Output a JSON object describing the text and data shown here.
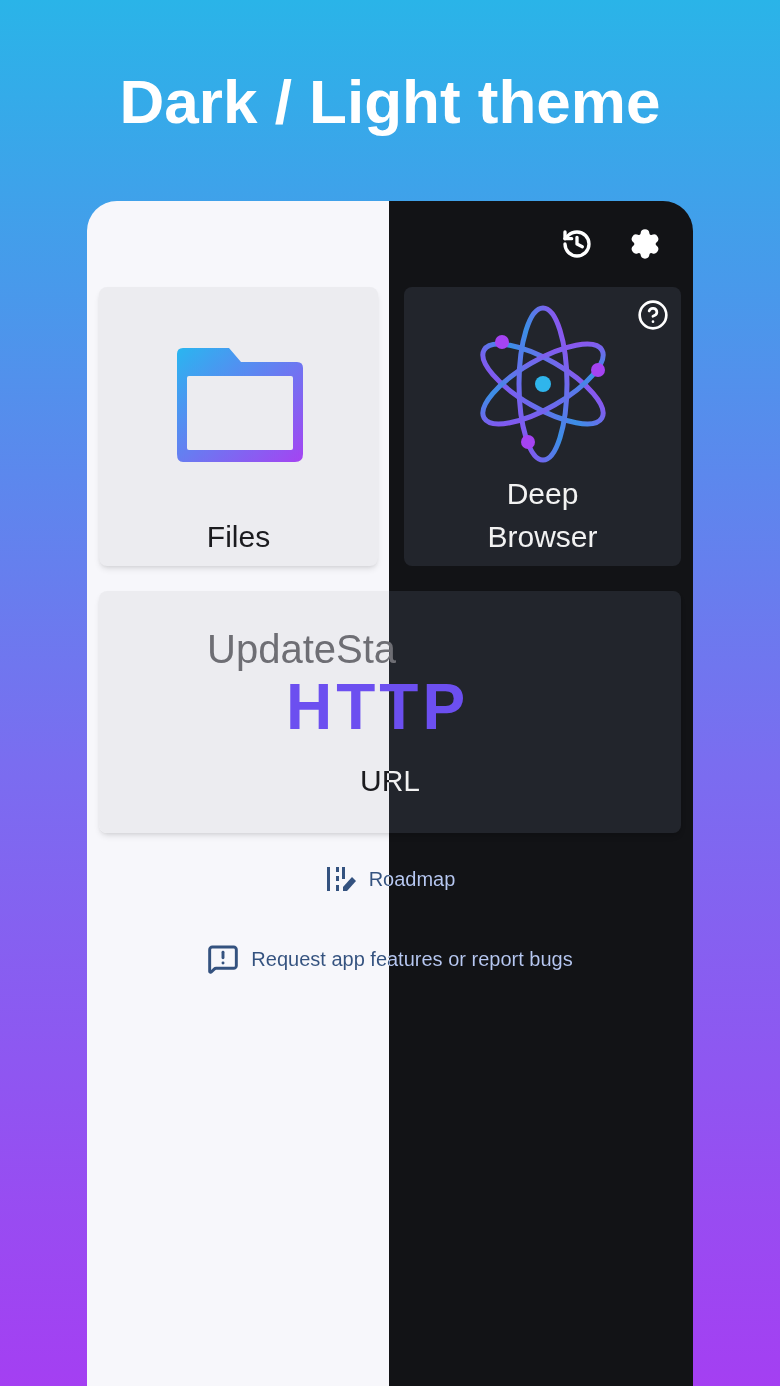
{
  "headline": "Dark / Light theme",
  "tiles": [
    {
      "kind": "files",
      "label": "Files"
    },
    {
      "kind": "browser",
      "label": "Deep Browser"
    }
  ],
  "url_tile": {
    "ghost": "UpdateSta",
    "logo": "HTTP",
    "label": "URL"
  },
  "links": [
    {
      "kind": "roadmap",
      "label": "Roadmap"
    },
    {
      "kind": "feedback",
      "label": "Request app features or report bugs"
    }
  ]
}
